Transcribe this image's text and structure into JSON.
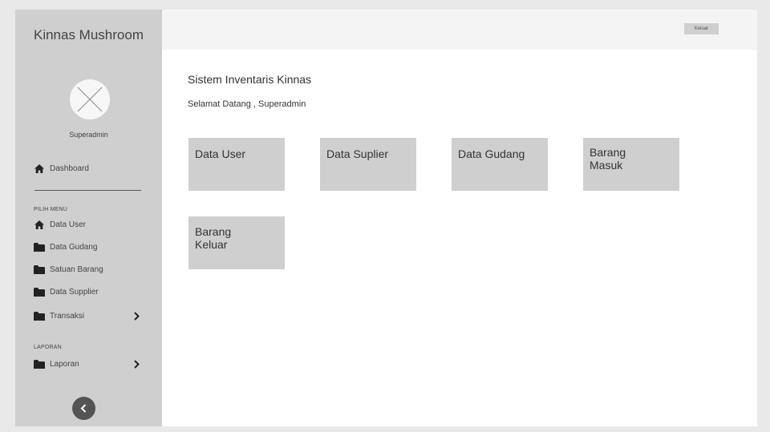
{
  "sidebar": {
    "brand": "Kinnas Mushroom",
    "user_name": "Superadmin",
    "dashboard_label": "Dashboard",
    "menu_section_label": "PILIH MENU",
    "menu_items": [
      {
        "label": "Data User",
        "icon": "home-icon"
      },
      {
        "label": "Data Gudang",
        "icon": "folder-icon"
      },
      {
        "label": "Satuan Barang",
        "icon": "folder-icon"
      },
      {
        "label": "Data Supplier",
        "icon": "folder-icon"
      },
      {
        "label": "Transaksi",
        "icon": "folder-icon",
        "has_submenu": true
      }
    ],
    "report_section_label": "LAPORAN",
    "report_items": [
      {
        "label": "Laporan",
        "icon": "folder-icon",
        "has_submenu": true
      }
    ],
    "collapse_icon": "chevron-left-icon"
  },
  "header": {
    "logout_label": "Keluar"
  },
  "main": {
    "title": "Sistem Inventaris Kinnas",
    "welcome": "Selamat Datang , Superadmin",
    "tiles": [
      {
        "label": "Data User"
      },
      {
        "label": "Data Suplier"
      },
      {
        "label": "Data Gudang"
      },
      {
        "label": "Barang Masuk"
      },
      {
        "label": "Barang Keluar"
      }
    ]
  },
  "colors": {
    "sidebar_bg": "#cfcfcf",
    "header_bg": "#f4f4f4",
    "tile_bg": "#cfcfcf",
    "collapse_button_bg": "#545454"
  }
}
